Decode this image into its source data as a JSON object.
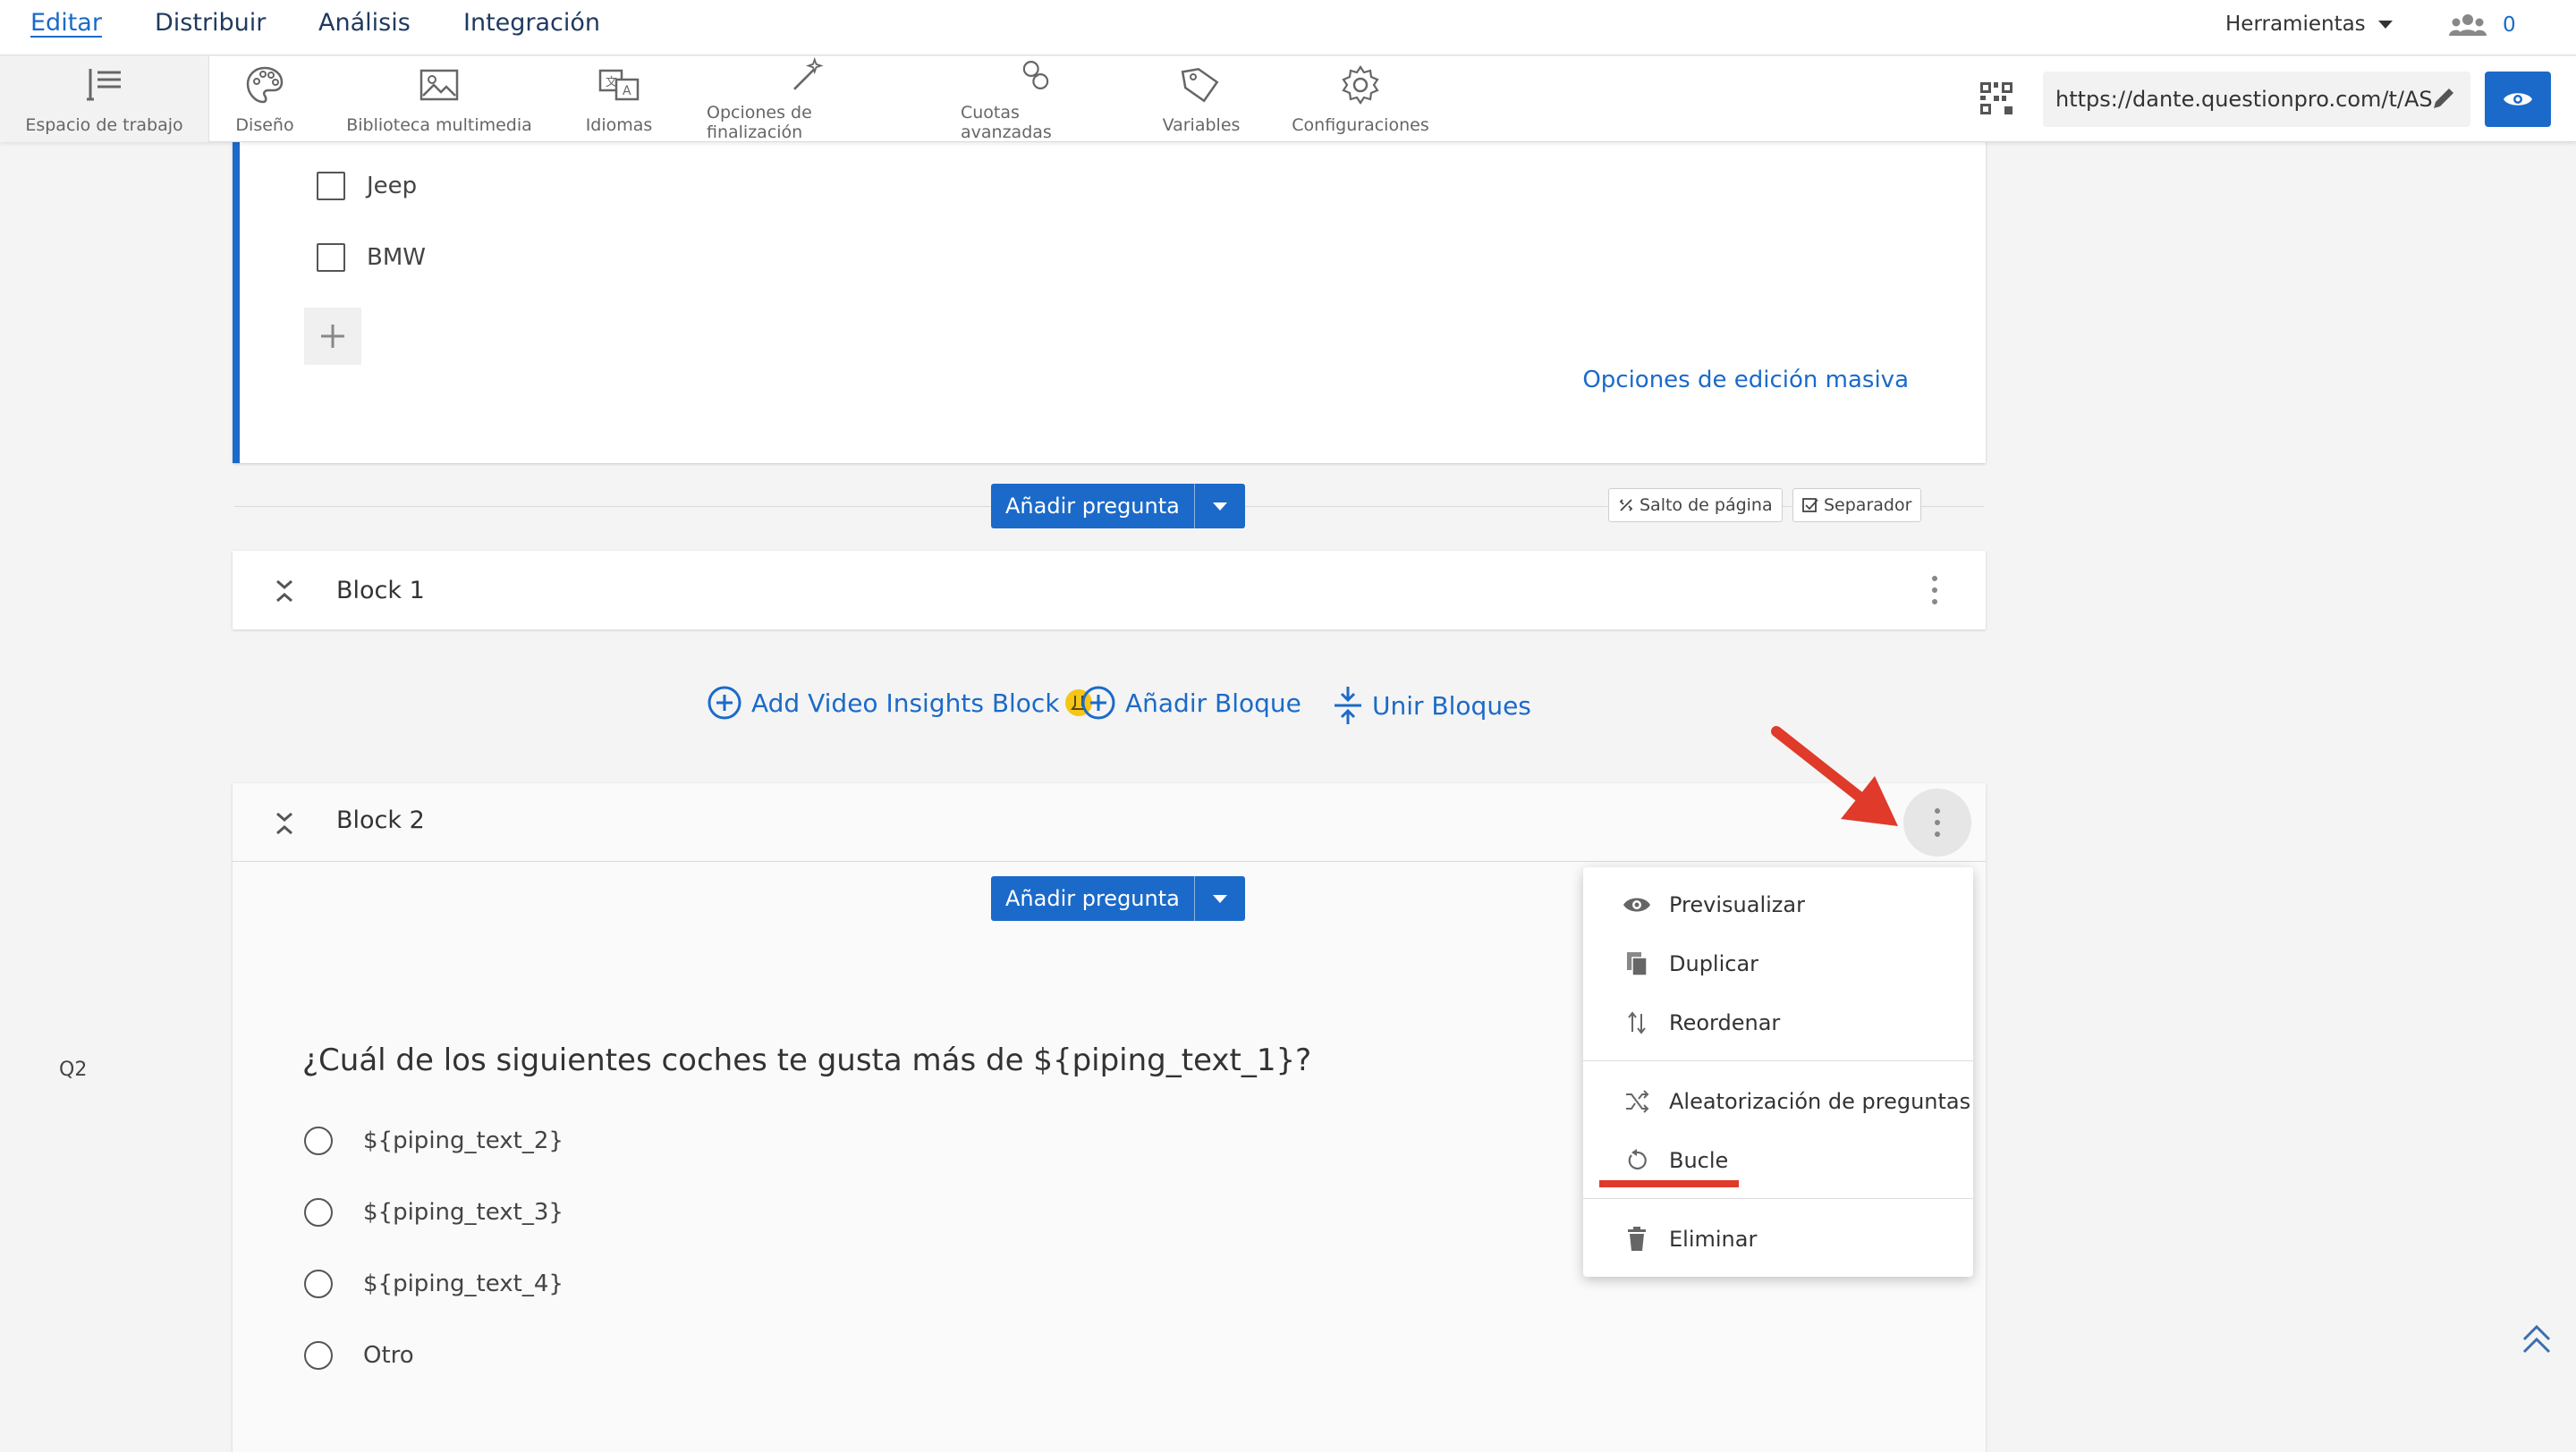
{
  "topnav": {
    "items": [
      "Editar",
      "Distribuir",
      "Análisis",
      "Integración"
    ],
    "tools_label": "Herramientas",
    "users_count": "0"
  },
  "toolbar": {
    "items": [
      {
        "label": "Espacio de trabajo",
        "icon": "workspace-icon"
      },
      {
        "label": "Diseño",
        "icon": "palette-icon"
      },
      {
        "label": "Biblioteca multimedia",
        "icon": "image-icon"
      },
      {
        "label": "Idiomas",
        "icon": "translate-icon"
      },
      {
        "label": "Opciones de finalización",
        "icon": "magic-wand-icon"
      },
      {
        "label": "Cuotas avanzadas",
        "icon": "quota-icon"
      },
      {
        "label": "Variables",
        "icon": "tag-icon"
      },
      {
        "label": "Configuraciones",
        "icon": "gear-icon"
      }
    ],
    "url": "https://dante.questionpro.com/t/AS"
  },
  "question1": {
    "options": [
      "Jeep",
      "BMW"
    ],
    "bulk_edit_label": "Opciones de edición masiva"
  },
  "add_question_label": "Añadir pregunta",
  "page_break_label": "Salto de página",
  "separator_label": "Separador",
  "block1": {
    "title": "Block 1"
  },
  "block_actions": {
    "video_insights": "Add Video Insights Block",
    "add_block": "Añadir Bloque",
    "merge_blocks": "Unir Bloques"
  },
  "block2": {
    "title": "Block 2"
  },
  "question2": {
    "number": "Q2",
    "text": "¿Cuál de los siguientes coches te gusta más de ${piping_text_1}?",
    "options": [
      "${piping_text_2}",
      "${piping_text_3}",
      "${piping_text_4}",
      "Otro"
    ]
  },
  "block_menu": {
    "preview": "Previsualizar",
    "duplicate": "Duplicar",
    "reorder": "Reordenar",
    "randomize": "Aleatorización de preguntas",
    "loop": "Bucle",
    "delete": "Eliminar"
  },
  "colors": {
    "accent": "#1b6ac9",
    "annotation": "#e03a2a"
  }
}
